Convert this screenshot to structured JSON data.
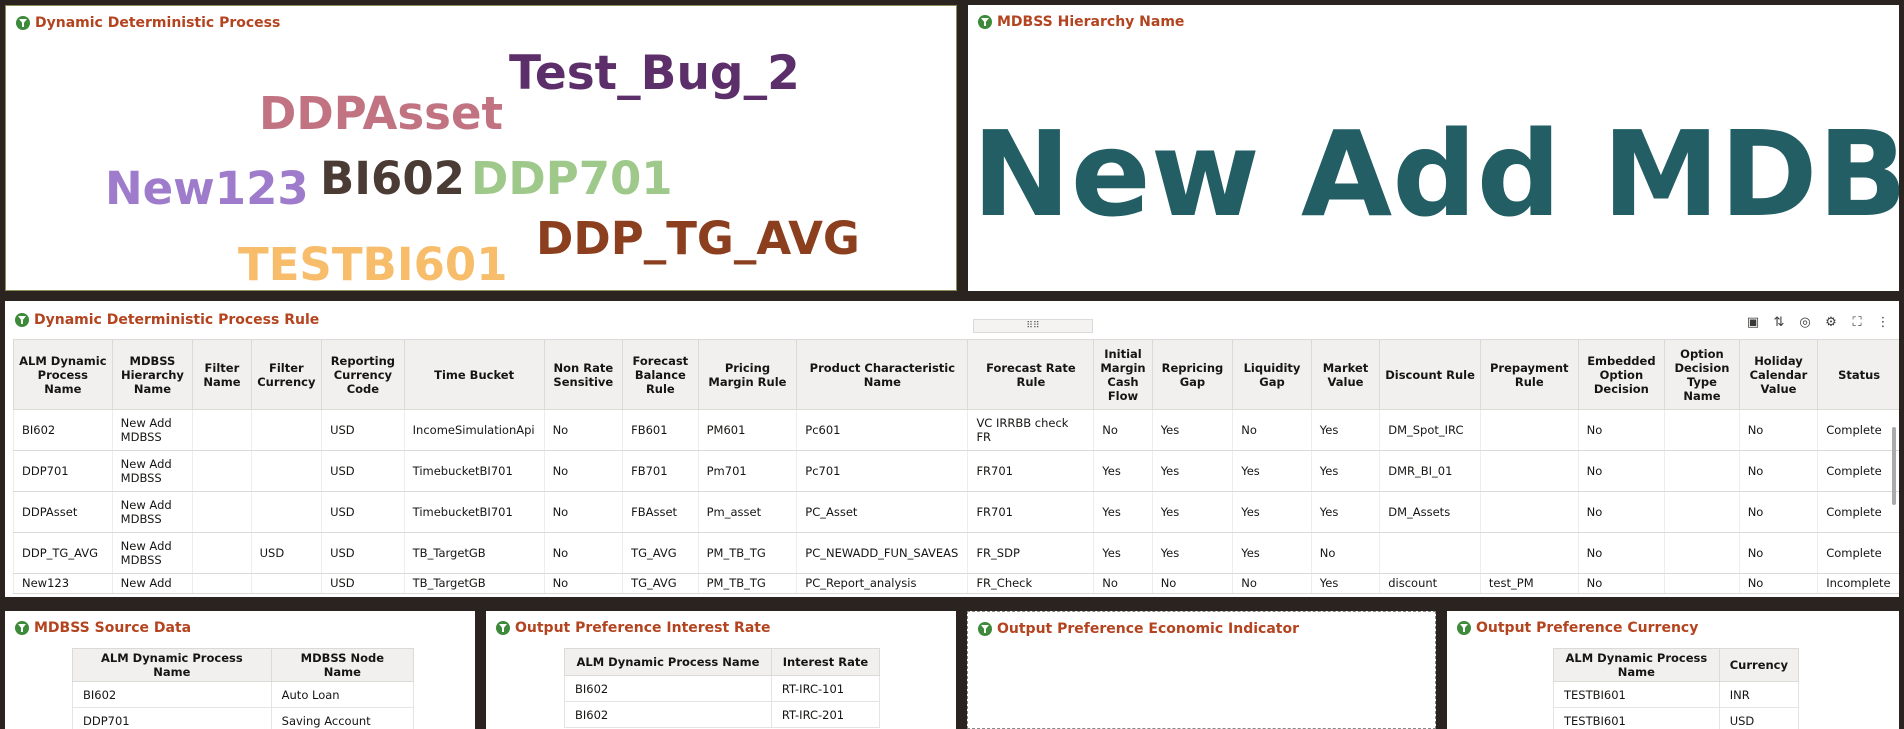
{
  "panels": {
    "ddp": {
      "title": "Dynamic Deterministic Process",
      "words": [
        {
          "text": "Test_Bug_2",
          "color": "#5c2f6b"
        },
        {
          "text": "DDPAsset",
          "color": "#c17382"
        },
        {
          "text": "New123",
          "color": "#9e7ccb"
        },
        {
          "text": "BI602",
          "color": "#4a3c34"
        },
        {
          "text": "DDP701",
          "color": "#9ec98a"
        },
        {
          "text": "DDP_TG_AVG",
          "color": "#8b3f1e"
        },
        {
          "text": "TESTBI601",
          "color": "#f7bd6b"
        }
      ]
    },
    "hierarchy": {
      "title": "MDBSS Hierarchy Name",
      "value": "New Add MDBSS",
      "color": "#225e64"
    },
    "rule": {
      "title": "Dynamic Deterministic Process Rule",
      "drag_handle": "⠿⠿",
      "toolbar_icons": [
        "chip-icon",
        "sort-icon",
        "target-icon",
        "chart-settings-icon",
        "fullscreen-icon",
        "more-icon"
      ],
      "columns": [
        "ALM Dynamic Process Name",
        "MDBSS Hierarchy Name",
        "Filter Name",
        "Filter Currency",
        "Reporting Currency Code",
        "Time Bucket",
        "Non Rate Sensitive",
        "Forecast Balance Rule",
        "Pricing Margin Rule",
        "Product Characteristic Name",
        "Forecast Rate Rule",
        "Initial Margin Cash Flow",
        "Repricing Gap",
        "Liquidity Gap",
        "Market Value",
        "Discount Rule",
        "Prepayment Rule",
        "Embedded Option Decision",
        "Option Decision Type Name",
        "Holiday Calendar Value",
        "Status"
      ],
      "rows": [
        [
          "BI602",
          "New Add MDBSS",
          "",
          "",
          "USD",
          "IncomeSimulationApi",
          "No",
          "FB601",
          "PM601",
          "Pc601",
          "VC IRRBB check FR",
          "No",
          "Yes",
          "No",
          "Yes",
          "DM_Spot_IRC",
          "",
          "No",
          "",
          "No",
          "Complete"
        ],
        [
          "DDP701",
          "New Add MDBSS",
          "",
          "",
          "USD",
          "TimebucketBI701",
          "No",
          "FB701",
          "Pm701",
          "Pc701",
          "FR701",
          "Yes",
          "Yes",
          "Yes",
          "Yes",
          "DMR_BI_01",
          "",
          "No",
          "",
          "No",
          "Complete"
        ],
        [
          "DDPAsset",
          "New Add MDBSS",
          "",
          "",
          "USD",
          "TimebucketBI701",
          "No",
          "FBAsset",
          "Pm_asset",
          "PC_Asset",
          "FR701",
          "Yes",
          "Yes",
          "Yes",
          "Yes",
          "DM_Assets",
          "",
          "No",
          "",
          "No",
          "Complete"
        ],
        [
          "DDP_TG_AVG",
          "New Add MDBSS",
          "",
          "USD",
          "USD",
          "TB_TargetGB",
          "No",
          "TG_AVG",
          "PM_TB_TG",
          "PC_NEWADD_FUN_SAVEAS",
          "FR_SDP",
          "Yes",
          "Yes",
          "Yes",
          "No",
          "",
          "",
          "No",
          "",
          "No",
          "Complete"
        ],
        [
          "New123",
          "New Add",
          "",
          "",
          "USD",
          "TB_TargetGB",
          "No",
          "TG_AVG",
          "PM_TB_TG",
          "PC_Report_analysis",
          "FR_Check",
          "No",
          "No",
          "No",
          "Yes",
          "discount",
          "test_PM",
          "No",
          "",
          "No",
          "Incomplete"
        ]
      ]
    },
    "source": {
      "title": "MDBSS Source Data",
      "columns": [
        "ALM Dynamic Process Name",
        "MDBSS Node Name"
      ],
      "rows": [
        [
          "BI602",
          "Auto Loan"
        ],
        [
          "DDP701",
          "Saving Account"
        ]
      ]
    },
    "interest": {
      "title": "Output Preference Interest Rate",
      "columns": [
        "ALM Dynamic Process Name",
        "Interest Rate"
      ],
      "rows": [
        [
          "BI602",
          "RT-IRC-101"
        ],
        [
          "BI602",
          "RT-IRC-201"
        ]
      ]
    },
    "economic": {
      "title": "Output Preference Economic Indicator"
    },
    "currency": {
      "title": "Output Preference Currency",
      "columns": [
        "ALM Dynamic Process Name",
        "Currency"
      ],
      "rows": [
        [
          "TESTBI601",
          "INR"
        ],
        [
          "TESTBI601",
          "USD"
        ]
      ]
    }
  }
}
